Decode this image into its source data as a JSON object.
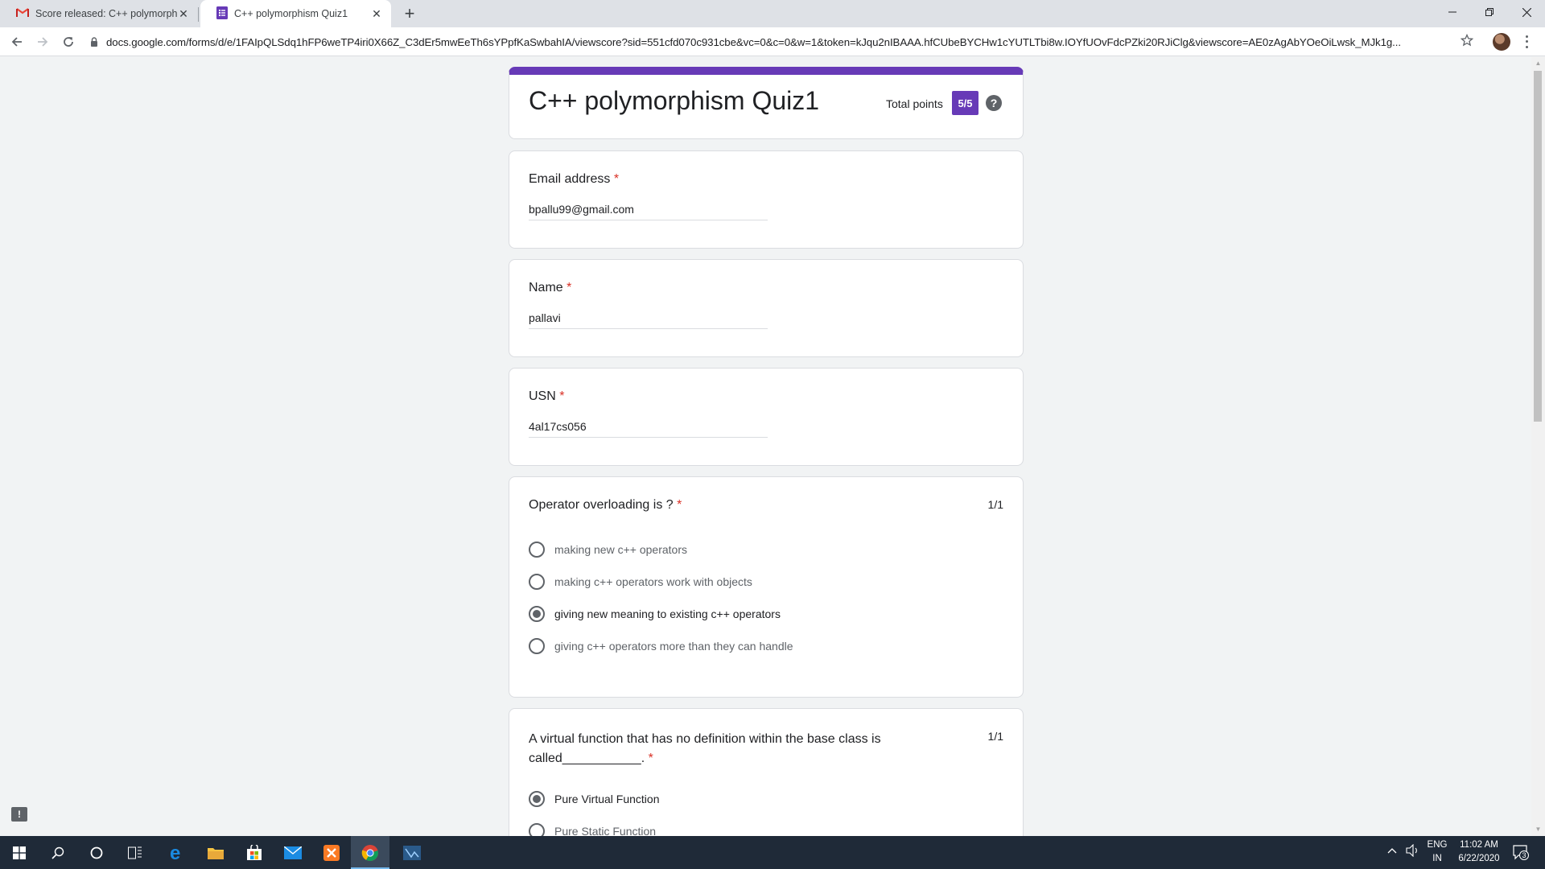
{
  "browser": {
    "tabs": [
      {
        "title": "Score released: C++ polymorphism",
        "icon": "gmail-icon"
      },
      {
        "title": "C++ polymorphism Quiz1",
        "icon": "google-forms-icon"
      }
    ],
    "url": "docs.google.com/forms/d/e/1FAIpQLSdq1hFP6weTP4iri0X66Z_C3dEr5mwEeTh6sYPpfKaSwbahIA/viewscore?sid=551cfd070c931cbe&vc=0&c=0&w=1&token=kJqu2nIBAAA.hfCUbeBYCHw1cYUTLTbi8w.IOYfUOvFdcPZki20RJiClg&viewscore=AE0zAgAbYOeOiLwsk_MJk1g..."
  },
  "form": {
    "title": "C++ polymorphism Quiz1",
    "total_points_label": "Total points",
    "score": "5/5",
    "accent_color": "#673ab7",
    "fields": [
      {
        "label": "Email address",
        "required_mark": "*",
        "value": "bpallu99@gmail.com"
      },
      {
        "label": "Name",
        "required_mark": "*",
        "value": "pallavi"
      },
      {
        "label": "USN",
        "required_mark": "*",
        "value": "4al17cs056"
      }
    ],
    "questions": [
      {
        "text": "Operator overloading is ?",
        "required_mark": "*",
        "points": "1/1",
        "options": [
          {
            "label": "making new c++ operators",
            "selected": false
          },
          {
            "label": "making c++ operators work with objects",
            "selected": false
          },
          {
            "label": "giving new meaning to existing c++ operators",
            "selected": true
          },
          {
            "label": "giving c++ operators more than they can handle",
            "selected": false
          }
        ]
      },
      {
        "text_line1": "A virtual function that has no definition within the base class is",
        "text_line2": "called___________.",
        "required_mark": "*",
        "points": "1/1",
        "options": [
          {
            "label": "Pure Virtual Function",
            "selected": true
          },
          {
            "label": "Pure Static Function",
            "selected": false
          }
        ]
      }
    ]
  },
  "taskbar": {
    "language": "ENG",
    "region": "IN",
    "time": "11:02 AM",
    "date": "6/22/2020",
    "notification_count": "3"
  }
}
